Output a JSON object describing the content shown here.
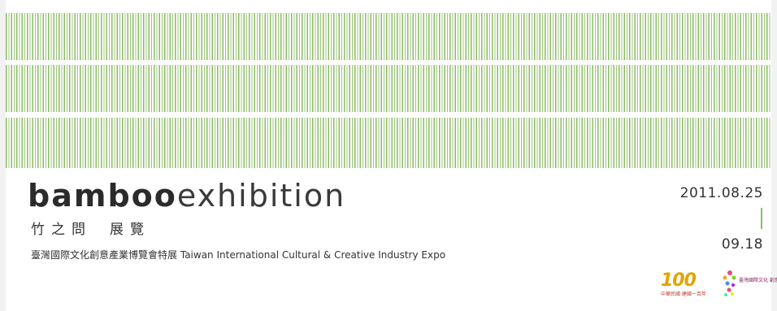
{
  "banner": {
    "title_bold": "bamboo",
    "title_light": "exhibition",
    "subtitle_zh_1": "竹之問",
    "subtitle_zh_2": "展覽",
    "expo_zh": "臺灣國際文化創意產業博覽會特展",
    "expo_en": "Taiwan International Cultural & Creative Industry Expo",
    "date_start": "2011.08.25",
    "date_end": "09.18"
  },
  "colors": {
    "bamboo_green": "#8dba66",
    "text": "#333333",
    "background": "#ffffff"
  },
  "logos": {
    "centennial_digits": "100",
    "centennial_caption": "中華民國 建國一百年",
    "expo_caption": "臺灣國際文化 創意產業博覽會"
  }
}
